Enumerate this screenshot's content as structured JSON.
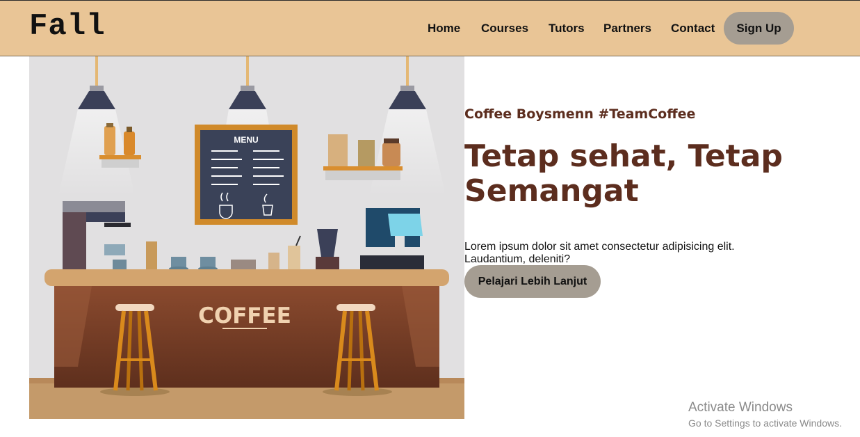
{
  "navbar": {
    "logo": "Fall",
    "links": [
      "Home",
      "Courses",
      "Tutors",
      "Partners",
      "Contact"
    ],
    "signup_label": "Sign Up"
  },
  "hero": {
    "tagline": "Coffee Boysmenn #TeamCoffee",
    "headline": "Tetap sehat, Tetap Semangat",
    "description": "Lorem ipsum dolor sit amet consectetur adipisicing elit. Laudantium, deleniti?",
    "cta_label": "Pelajari Lebih Lanjut",
    "image": {
      "menu_board_title": "MENU",
      "counter_sign": "COFFEE"
    }
  },
  "watermark": {
    "title": "Activate Windows",
    "subtitle": "Go to Settings to activate Windows."
  },
  "colors": {
    "navbar_bg": "#e9c596",
    "button_bg": "#a59d92",
    "heading": "#5c2d1e"
  }
}
